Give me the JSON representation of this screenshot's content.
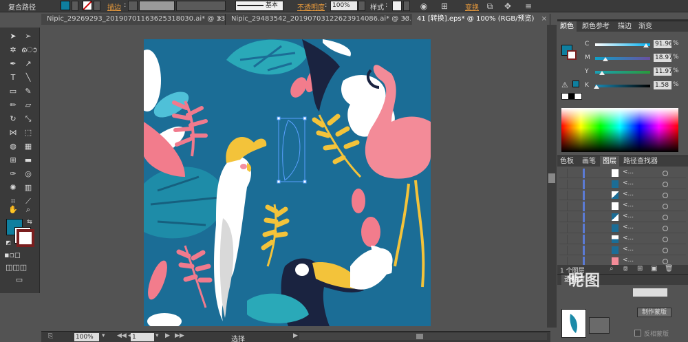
{
  "control_bar": {
    "selection_type": "复合路径",
    "fill_color": "#0f7f9f",
    "stroke_label": "描边",
    "stroke_style_label": "基本",
    "opacity_label": "不透明度",
    "opacity_value": "100%",
    "style_label": "样式",
    "transform_label": "变换"
  },
  "tabs": [
    {
      "label": "Nipic_29269293_20190701163625318030.ai* @ 33...",
      "close": "×"
    },
    {
      "label": "Nipic_29483542_20190703122623914086.ai* @ 33...",
      "close": "×"
    },
    {
      "label": "41 [转换].eps* @ 100% (RGB/预览)",
      "close": "×"
    }
  ],
  "status_bar": {
    "zoom": "100%",
    "page": "1",
    "tool_status": "选择"
  },
  "color_panel": {
    "tabs": [
      "颜色",
      "颜色参考",
      "描边",
      "渐变"
    ],
    "active_tab": "颜色",
    "channels": [
      {
        "label": "C",
        "value": "91.96",
        "unit": "%",
        "fraction": 0.92
      },
      {
        "label": "M",
        "value": "18.97",
        "unit": "%",
        "fraction": 0.19
      },
      {
        "label": "Y",
        "value": "11.97",
        "unit": "%",
        "fraction": 0.12
      },
      {
        "label": "K",
        "value": "1.58",
        "unit": "%",
        "fraction": 0.02
      }
    ]
  },
  "layers_panel": {
    "tabs": [
      "色板",
      "画笔",
      "图层",
      "路径查找器"
    ],
    "active_tab": "图层",
    "rows": [
      {
        "name": "<..."
      },
      {
        "name": "<..."
      },
      {
        "name": "<..."
      },
      {
        "name": "<..."
      },
      {
        "name": "<..."
      },
      {
        "name": "<..."
      },
      {
        "name": "<..."
      },
      {
        "name": "<..."
      },
      {
        "name": "<..."
      }
    ],
    "count": "1 个图层"
  },
  "transparency_panel": {
    "title": "透明度",
    "make_mask": "制作蒙版",
    "invert_mask": "反相蒙版"
  },
  "watermark": "昵图"
}
